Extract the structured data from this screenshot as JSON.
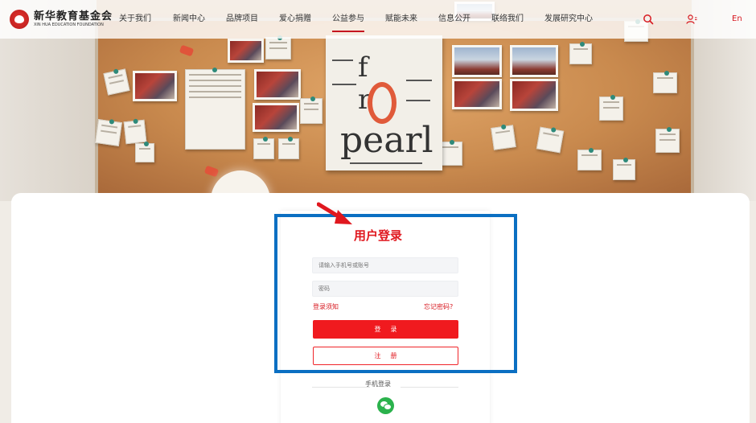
{
  "header": {
    "logo": {
      "name_cn": "新华教育基金会",
      "name_en": "XIN HUA EDUCATION FOUNDATION"
    },
    "nav": [
      {
        "label": "关于我们",
        "active": false
      },
      {
        "label": "新闻中心",
        "active": false
      },
      {
        "label": "品牌项目",
        "active": false
      },
      {
        "label": "爱心捐赠",
        "active": false
      },
      {
        "label": "公益参与",
        "active": true
      },
      {
        "label": "赋能未来",
        "active": false
      },
      {
        "label": "信息公开",
        "active": false
      },
      {
        "label": "联络我们",
        "active": false
      },
      {
        "label": "发展研究中心",
        "active": false
      }
    ],
    "language_label": "En",
    "icons": {
      "search": "search-icon",
      "user": "user-icon"
    },
    "accent_color": "#d71920"
  },
  "hero": {
    "poster": {
      "line1": "f  r",
      "line2": "pearl"
    }
  },
  "login": {
    "title": "用户登录",
    "account_placeholder": "请输入手机号或账号",
    "password_placeholder": "密码",
    "notice_link": "登录须知",
    "forgot_link": "忘记密码?",
    "login_button": "登录",
    "register_button": "注册",
    "alt_login_label": "手机登录",
    "alt_login_icon": "wechat-icon",
    "primary_color": "#f01a1f"
  },
  "annotations": {
    "highlight_color": "#0b6fc2",
    "arrow_color": "#e0181f"
  }
}
